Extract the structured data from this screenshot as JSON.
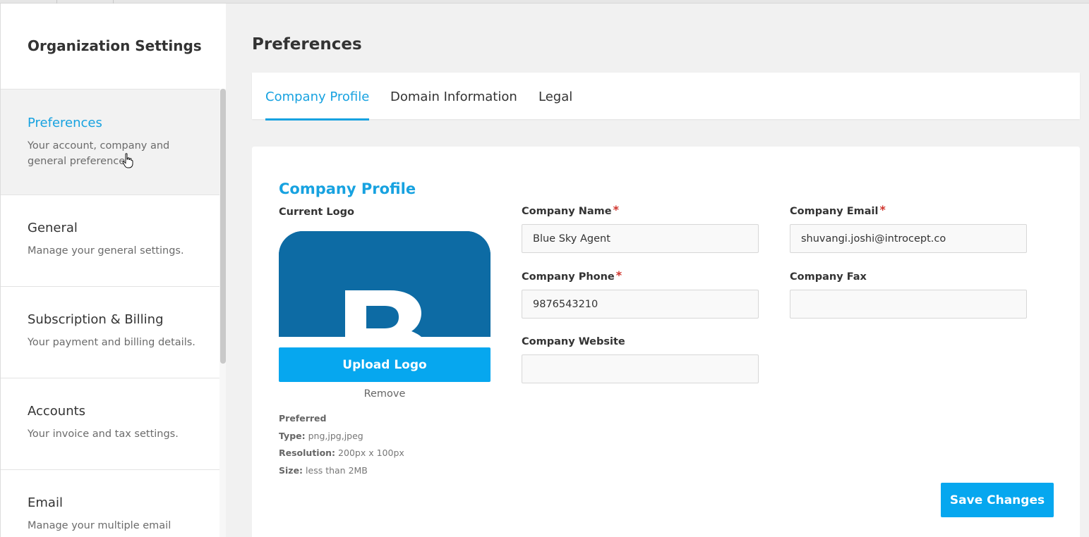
{
  "sidebar": {
    "title": "Organization Settings",
    "items": [
      {
        "label": "Preferences",
        "desc": "Your account, company and general preferences.",
        "active": true
      },
      {
        "label": "General",
        "desc": "Manage your general settings."
      },
      {
        "label": "Subscription & Billing",
        "desc": "Your payment and billing details."
      },
      {
        "label": "Accounts",
        "desc": "Your invoice and tax settings."
      },
      {
        "label": "Email",
        "desc": "Manage your multiple email"
      }
    ]
  },
  "page": {
    "title": "Preferences"
  },
  "tabs": [
    {
      "label": "Company Profile",
      "active": true
    },
    {
      "label": "Domain Information"
    },
    {
      "label": "Legal"
    }
  ],
  "profile": {
    "section_title": "Company Profile",
    "logo": {
      "label": "Current Logo",
      "upload_label": "Upload Logo",
      "remove_label": "Remove",
      "preferred_label": "Preferred",
      "type_label": "Type:",
      "type_value": "png,jpg,jpeg",
      "resolution_label": "Resolution:",
      "resolution_value": "200px x 100px",
      "size_label": "Size:",
      "size_value": "less than 2MB",
      "bg_color": "#0d6ba4"
    },
    "fields": {
      "company_name": {
        "label": "Company Name",
        "required": "*",
        "value": "Blue Sky Agent"
      },
      "company_email": {
        "label": "Company Email",
        "required": "*",
        "value": "shuvangi.joshi@introcept.co"
      },
      "company_phone": {
        "label": "Company Phone",
        "required": "*",
        "value": "9876543210"
      },
      "company_fax": {
        "label": "Company Fax",
        "value": ""
      },
      "company_website": {
        "label": "Company Website",
        "value": ""
      }
    },
    "save_label": "Save Changes"
  },
  "colors": {
    "accent": "#17a2e0",
    "button": "#06a7ef",
    "required": "#d0342c"
  }
}
